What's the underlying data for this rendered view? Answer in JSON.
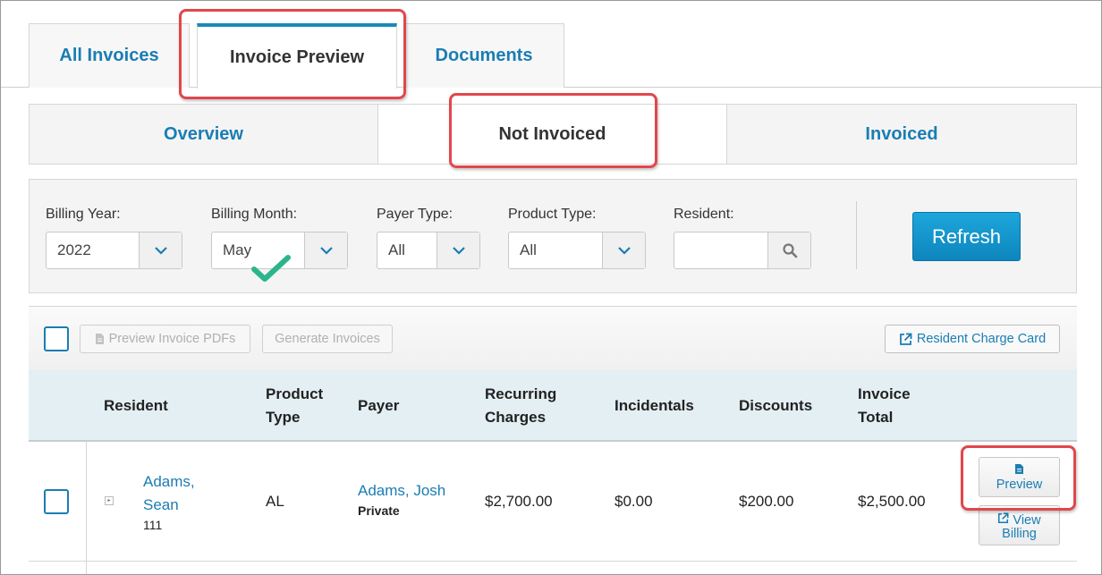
{
  "top_tabs": [
    {
      "label": "All Invoices"
    },
    {
      "label": "Invoice Preview"
    },
    {
      "label": "Documents"
    }
  ],
  "sub_tabs": [
    {
      "label": "Overview"
    },
    {
      "label": "Not Invoiced"
    },
    {
      "label": "Invoiced"
    }
  ],
  "filters": {
    "billing_year": {
      "label": "Billing Year:",
      "value": "2022"
    },
    "billing_month": {
      "label": "Billing Month:",
      "value": "May"
    },
    "payer_type": {
      "label": "Payer Type:",
      "value": "All"
    },
    "product_type": {
      "label": "Product Type:",
      "value": "All"
    },
    "resident": {
      "label": "Resident:",
      "value": ""
    },
    "refresh_label": "Refresh"
  },
  "toolbar": {
    "preview_pdfs_label": "Preview Invoice PDFs",
    "generate_label": "Generate Invoices",
    "charge_card_label": "Resident Charge Card"
  },
  "columns": {
    "resident": "Resident",
    "product_type_1": "Product",
    "product_type_2": "Type",
    "payer": "Payer",
    "recurring_1": "Recurring",
    "recurring_2": "Charges",
    "incidentals": "Incidentals",
    "discounts": "Discounts",
    "total_1": "Invoice",
    "total_2": "Total"
  },
  "rows": [
    {
      "resident_line1": "Adams,",
      "resident_line2": "Sean",
      "room": "111",
      "product_type": "AL",
      "payer_name": "Adams, Josh",
      "payer_type": "Private",
      "recurring": "$2,700.00",
      "incidentals": "$0.00",
      "discounts": "$200.00",
      "total": "$2,500.00",
      "preview_label": "Preview",
      "view_billing_line1": "View",
      "view_billing_line2": "Billing"
    }
  ],
  "colors": {
    "accent": "#1a7db3",
    "highlight": "#e0474c",
    "checkmark": "#2bb58c",
    "refresh": "#1596cc"
  }
}
